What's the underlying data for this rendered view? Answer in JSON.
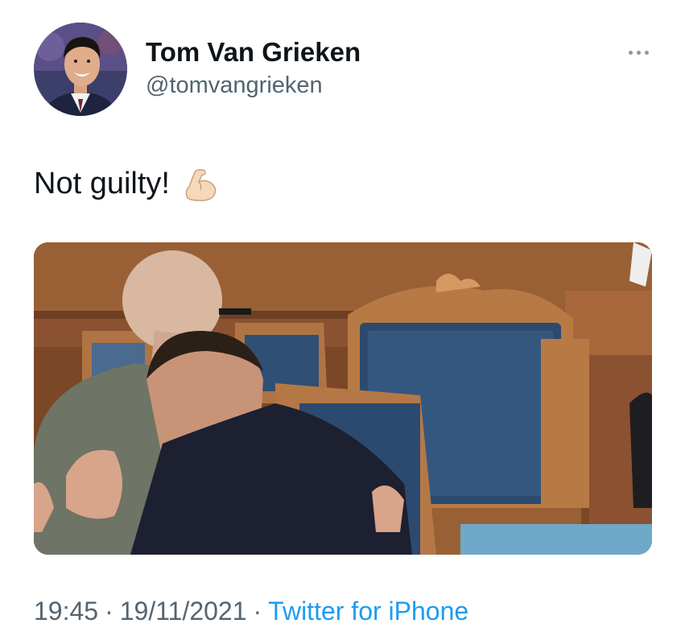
{
  "author": {
    "name": "Tom Van Grieken",
    "handle": "@tomvangrieken"
  },
  "tweet": {
    "text": "Not guilty!",
    "emoji": "flexed-biceps",
    "media_kind": "photo"
  },
  "meta": {
    "time": "19:45",
    "date": "19/11/2021",
    "separator": "·",
    "source": "Twitter for iPhone"
  },
  "icons": {
    "more": "more-options-icon"
  },
  "colors": {
    "text": "#0f1419",
    "secondary": "#536471",
    "link": "#1d9bf0"
  }
}
